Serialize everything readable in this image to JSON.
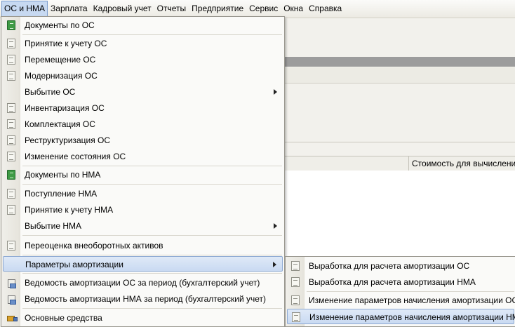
{
  "menubar": {
    "items": [
      "ОС и НМА",
      "Зарплата",
      "Кадровый учет",
      "Отчеты",
      "Предприятие",
      "Сервис",
      "Окна",
      "Справка"
    ]
  },
  "background": {
    "table_column_label": "Стоимость для вычисления а"
  },
  "menu": {
    "items": [
      {
        "label": "Документы по ОС",
        "icon": "green-book-icon"
      },
      {
        "label": "Принятие к учету ОС",
        "icon": "document-icon"
      },
      {
        "label": "Перемещение ОС",
        "icon": "document-icon"
      },
      {
        "label": "Модернизация ОС",
        "icon": "document-icon"
      },
      {
        "label": "Выбытие ОС",
        "icon": "none"
      },
      {
        "label": "Инвентаризация ОС",
        "icon": "document-icon"
      },
      {
        "label": "Комплектация ОС",
        "icon": "document-icon"
      },
      {
        "label": "Реструктуризация ОС",
        "icon": "document-icon"
      },
      {
        "label": "Изменение состояния ОС",
        "icon": "document-icon"
      },
      {
        "label": "Документы по НМА",
        "icon": "green-book-icon"
      },
      {
        "label": "Поступление НМА",
        "icon": "document-icon"
      },
      {
        "label": "Принятие к учету НМА",
        "icon": "document-icon"
      },
      {
        "label": "Выбытие НМА",
        "icon": "none"
      },
      {
        "label": "Переоценка внеоборотных активов",
        "icon": "document-icon"
      },
      {
        "label": "Параметры амортизации",
        "icon": "none"
      },
      {
        "label": "Ведомость амортизации ОС за период (бухгалтерский учет)",
        "icon": "report-icon"
      },
      {
        "label": "Ведомость амортизации НМА за период (бухгалтерский учет)",
        "icon": "report-icon"
      },
      {
        "label": "Основные средства",
        "icon": "truck-icon"
      }
    ]
  },
  "submenu": {
    "items": [
      {
        "label": "Выработка для расчета амортизации ОС",
        "icon": "document-icon"
      },
      {
        "label": "Выработка для расчета амортизации НМА",
        "icon": "document-icon"
      },
      {
        "label": "Изменение параметров начисления амортизации ОС",
        "icon": "document-icon"
      },
      {
        "label": "Изменение параметров начисления амортизации НМА",
        "icon": "document-icon"
      }
    ]
  },
  "colors": {
    "highlight": "#c9daf2",
    "highlight_border": "#8eaad3",
    "menu_bg": "#fafaf8"
  }
}
